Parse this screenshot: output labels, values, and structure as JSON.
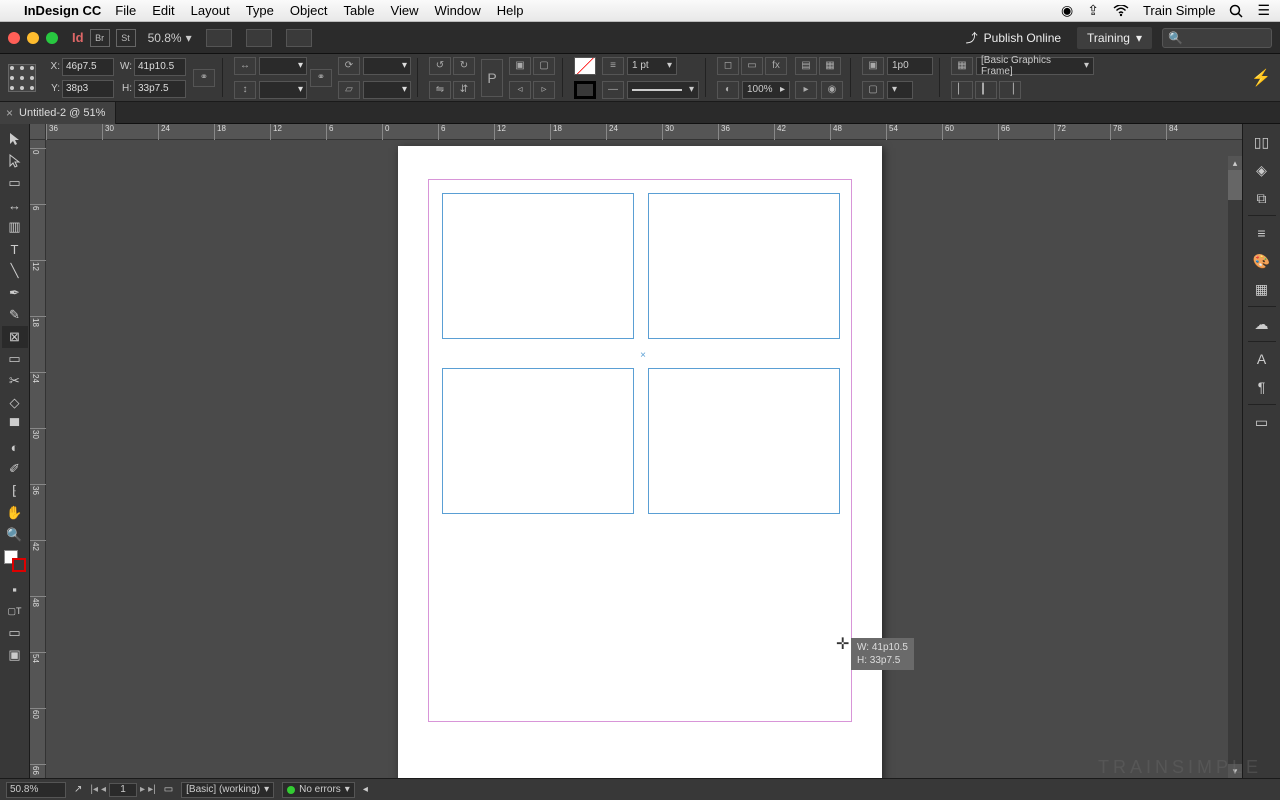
{
  "mac_menu": {
    "app": "InDesign CC",
    "items": [
      "File",
      "Edit",
      "Layout",
      "Type",
      "Object",
      "Table",
      "View",
      "Window",
      "Help"
    ],
    "account": "Train Simple"
  },
  "app_bar": {
    "zoom": "50.8%",
    "publish": "Publish Online",
    "workspace": "Training"
  },
  "control": {
    "x": "46p7.5",
    "y": "38p3",
    "w": "41p10.5",
    "h": "33p7.5",
    "stroke_weight": "1 pt",
    "opacity": "100%",
    "gap": "1p0",
    "style": "[Basic Graphics Frame]"
  },
  "doc_tab": "Untitled-2 @ 51%",
  "h_ruler_ticks": [
    "36",
    "30",
    "24",
    "18",
    "12",
    "6",
    "0",
    "6",
    "12",
    "18",
    "24",
    "30",
    "36",
    "42",
    "48",
    "54",
    "60",
    "66",
    "72",
    "78",
    "84"
  ],
  "v_ruler_ticks": [
    "0",
    "6",
    "12",
    "18",
    "24",
    "30",
    "36",
    "42",
    "48",
    "54",
    "60",
    "66"
  ],
  "tooltip": {
    "w": "W: 41p10.5",
    "h": "H: 33p7.5"
  },
  "status": {
    "zoom": "50.8%",
    "page": "1",
    "layout": "[Basic] (working)",
    "errors": "No errors"
  },
  "watermark": "TRAINSIMPLE"
}
